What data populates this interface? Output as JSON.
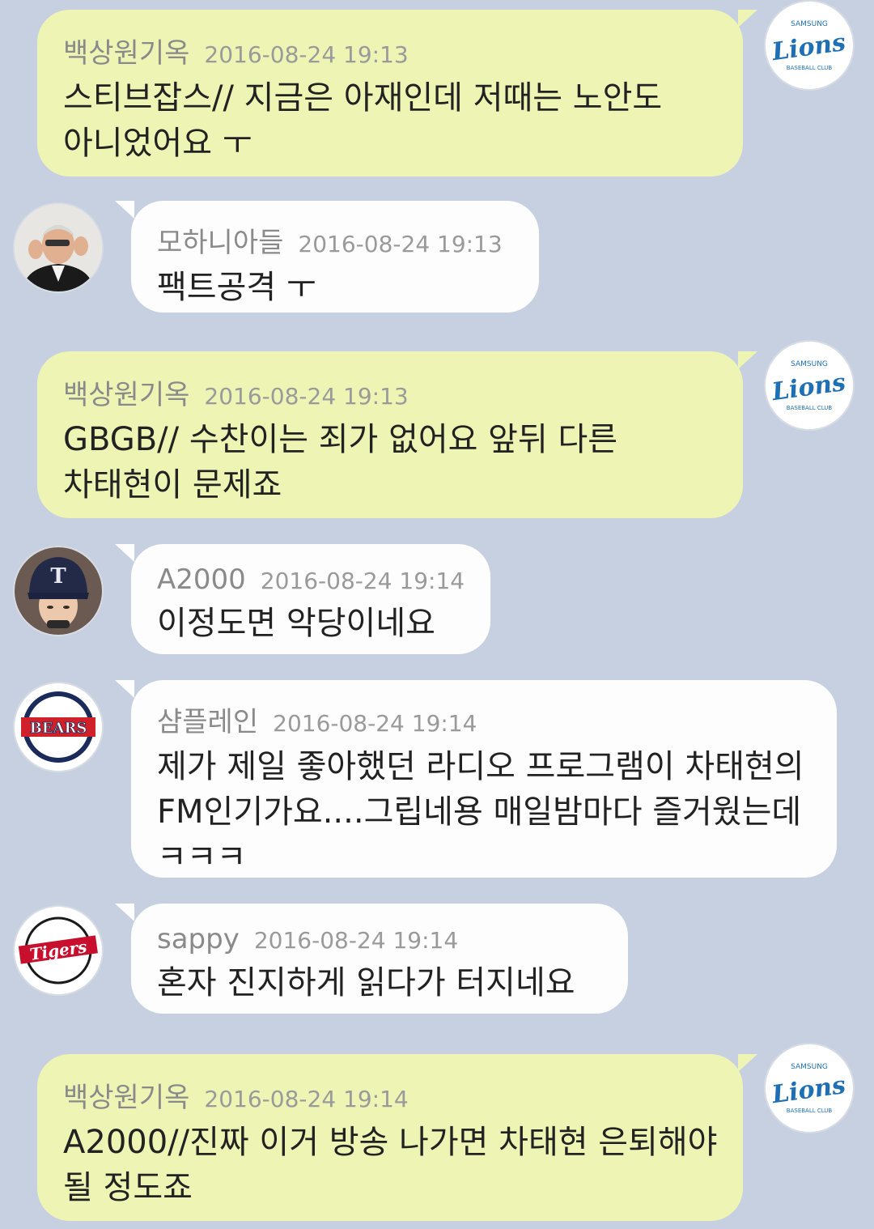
{
  "messages": [
    {
      "side": "right",
      "nick": "백상원기옥",
      "time": "2016-08-24 19:13",
      "text": "스티브잡스// 지금은 아재인데 저때는 노안도 아니었어요 ㅜ",
      "avatar": "lions-logo-icon",
      "avatar_text": "Lions"
    },
    {
      "side": "left",
      "nick": "모하니아들",
      "time": "2016-08-24 19:13",
      "text": "팩트공격 ㅜ",
      "avatar": "man-photo-avatar"
    },
    {
      "side": "right",
      "nick": "백상원기옥",
      "time": "2016-08-24 19:13",
      "text": "GBGB// 수찬이는 죄가 없어요 앞뒤 다른 차태현이 문제죠",
      "avatar": "lions-logo-icon",
      "avatar_text": "Lions"
    },
    {
      "side": "left",
      "nick": "A2000",
      "time": "2016-08-24 19:14",
      "text": "이정도면 악당이네요",
      "avatar": "woman-cap-photo-avatar"
    },
    {
      "side": "left",
      "nick": "샴플레인",
      "time": "2016-08-24 19:14",
      "text": "제가 제일 좋아했던 라디오 프로그램이 차태현의 FM인기가요....그립네용 매일밤마다 즐거웠는데 ㅋㅋㅋ",
      "avatar": "bears-logo-icon",
      "avatar_text": "BEARS"
    },
    {
      "side": "left",
      "nick": "sappy",
      "time": "2016-08-24 19:14",
      "text": "혼자 진지하게 읽다가 터지네요",
      "avatar": "tigers-logo-icon",
      "avatar_text": "Tigers"
    },
    {
      "side": "right",
      "nick": "백상원기옥",
      "time": "2016-08-24 19:14",
      "text": "A2000//진짜 이거 방송 나가면 차태현 은퇴해야 될 정도죠",
      "avatar": "lions-logo-icon",
      "avatar_text": "Lions"
    }
  ],
  "colors": {
    "background": "#c6d0e0",
    "mine_bubble": "#eef5b4",
    "other_bubble": "#fdfdfd",
    "lions_blue": "#1f6fb5",
    "bears_navy": "#1a2a5a",
    "bears_red": "#d0202a",
    "tigers_red": "#c8102e"
  }
}
